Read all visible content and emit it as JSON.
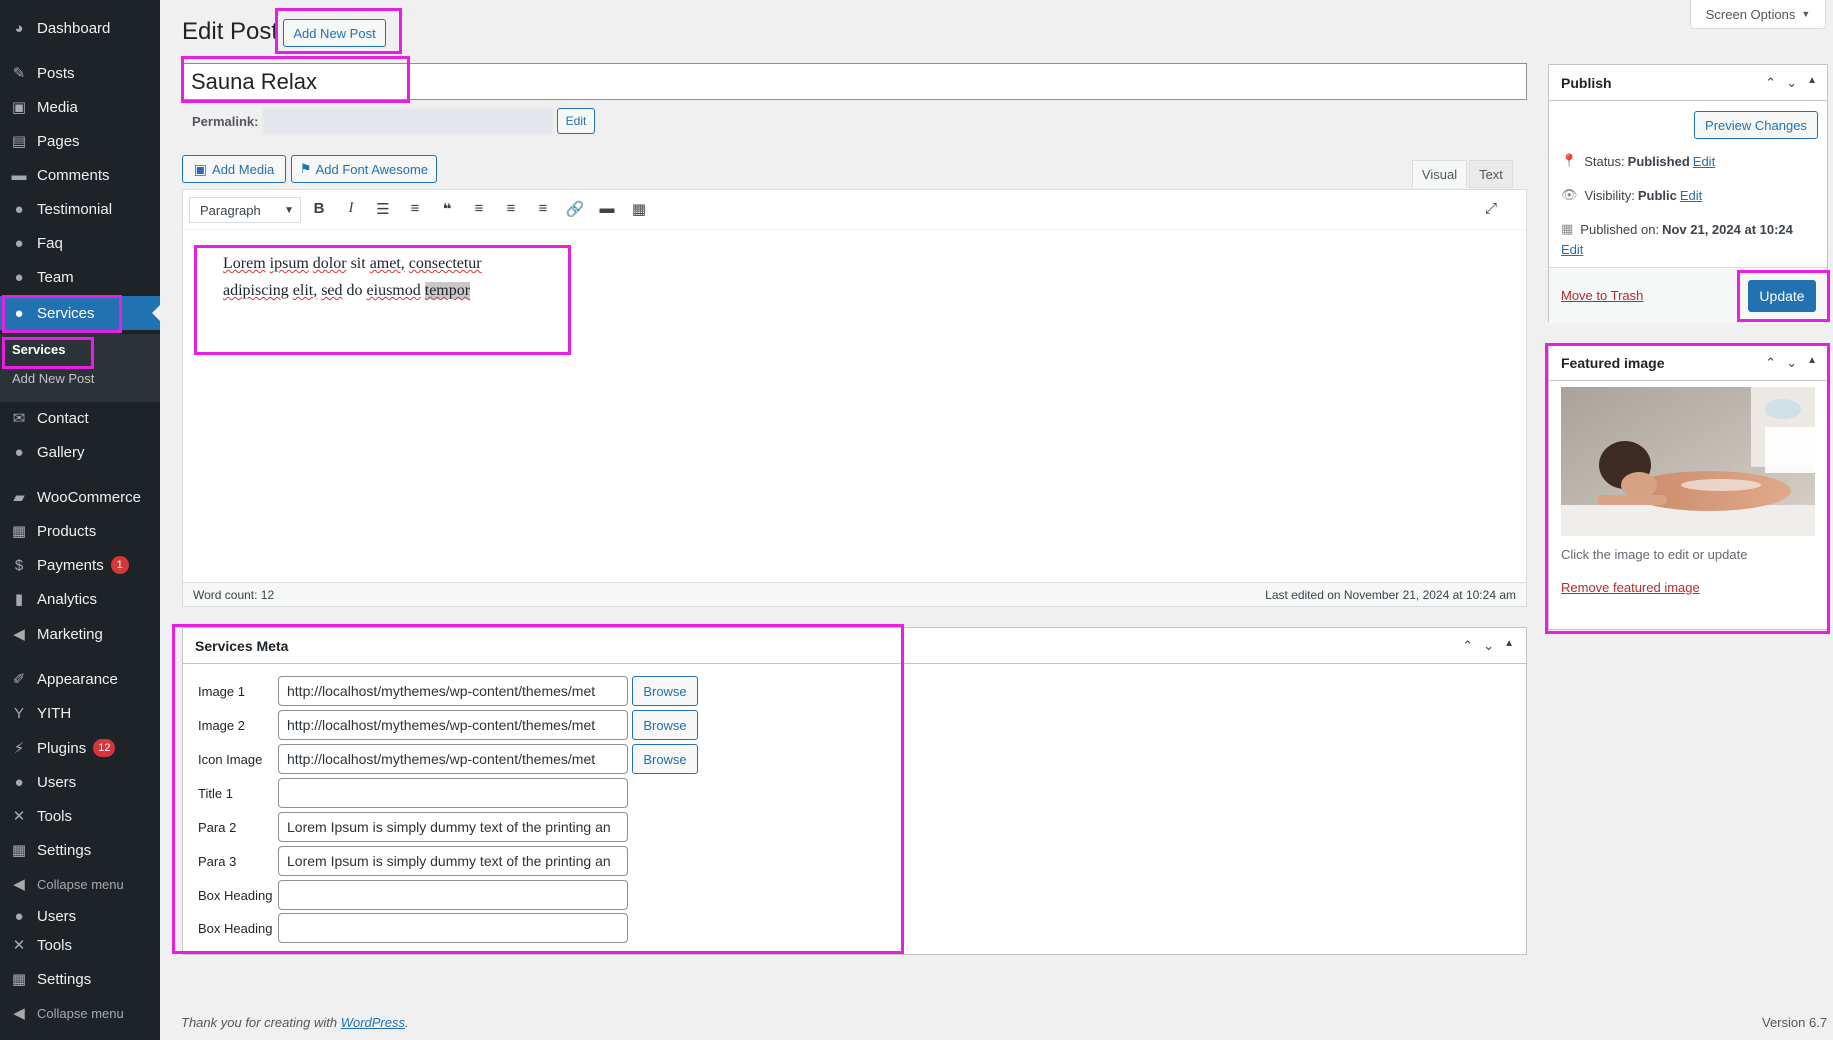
{
  "sidebar": {
    "items": [
      {
        "label": "Dashboard",
        "icon": "dashboard-icon",
        "glyph": "◕"
      },
      {
        "label": "Posts",
        "icon": "pushpin-icon",
        "glyph": "✎"
      },
      {
        "label": "Media",
        "icon": "media-icon",
        "glyph": "▣"
      },
      {
        "label": "Pages",
        "icon": "pages-icon",
        "glyph": "▤"
      },
      {
        "label": "Comments",
        "icon": "comments-icon",
        "glyph": "▬"
      },
      {
        "label": "Testimonial",
        "icon": "user-icon",
        "glyph": "●"
      },
      {
        "label": "Faq",
        "icon": "user-icon",
        "glyph": "●"
      },
      {
        "label": "Team",
        "icon": "user-icon",
        "glyph": "●"
      },
      {
        "label": "Services",
        "icon": "user-icon",
        "glyph": "●"
      },
      {
        "label": "Contact",
        "icon": "mail-icon",
        "glyph": "✉"
      },
      {
        "label": "Gallery",
        "icon": "user-icon",
        "glyph": "●"
      },
      {
        "label": "WooCommerce",
        "icon": "woocommerce-icon",
        "glyph": "▰"
      },
      {
        "label": "Products",
        "icon": "products-icon",
        "glyph": "▦"
      },
      {
        "label": "Payments",
        "icon": "payments-icon",
        "glyph": "$",
        "badge": "1"
      },
      {
        "label": "Analytics",
        "icon": "analytics-icon",
        "glyph": "▮"
      },
      {
        "label": "Marketing",
        "icon": "megaphone-icon",
        "glyph": "◀"
      },
      {
        "label": "Appearance",
        "icon": "brush-icon",
        "glyph": "✐"
      },
      {
        "label": "YITH",
        "icon": "yith-icon",
        "glyph": "Y"
      },
      {
        "label": "Plugins",
        "icon": "plugins-icon",
        "glyph": "⚡",
        "badge": "12"
      },
      {
        "label": "Users",
        "icon": "users-icon",
        "glyph": "●"
      },
      {
        "label": "Tools",
        "icon": "wrench-icon",
        "glyph": "✕"
      },
      {
        "label": "Settings",
        "icon": "settings-icon",
        "glyph": "▦"
      },
      {
        "label": "Collapse menu",
        "icon": "collapse-icon",
        "glyph": "◀"
      },
      {
        "label": "Users",
        "icon": "users-icon",
        "glyph": "●"
      },
      {
        "label": "Tools",
        "icon": "wrench-icon",
        "glyph": "✕"
      },
      {
        "label": "Settings",
        "icon": "settings-icon",
        "glyph": "▦"
      },
      {
        "label": "Collapse menu",
        "icon": "collapse-icon",
        "glyph": "◀"
      }
    ],
    "submenu": [
      "Services",
      "Add New Post"
    ]
  },
  "header": {
    "title": "Edit Post",
    "add_new": "Add New Post",
    "screen_options": "Screen Options"
  },
  "post": {
    "title": "Sauna Relax",
    "permalink_label": "Permalink:",
    "permalink_edit": "Edit"
  },
  "media_buttons": {
    "add_media": "Add Media",
    "add_font_awesome": "Add Font Awesome"
  },
  "editor": {
    "tab_visual": "Visual",
    "tab_text": "Text",
    "format_select": "Paragraph",
    "content_words": [
      "Lorem",
      "ipsum",
      "dolor",
      "sit",
      "amet,",
      "consectetur",
      "adipiscing",
      "elit,",
      "sed",
      "do",
      "eiusmod",
      "tempor"
    ],
    "word_count": "Word count: 12",
    "last_edited": "Last edited on November 21, 2024 at 10:24 am"
  },
  "services_meta": {
    "title": "Services Meta",
    "browse": "Browse",
    "rows": [
      {
        "label": "Image 1",
        "value": "http://localhost/mythemes/wp-content/themes/met"
      },
      {
        "label": "Image 2",
        "value": "http://localhost/mythemes/wp-content/themes/met"
      },
      {
        "label": "Icon Image",
        "value": "http://localhost/mythemes/wp-content/themes/met"
      },
      {
        "label": "Title 1",
        "value": ""
      },
      {
        "label": "Para 2",
        "value": "Lorem Ipsum is simply dummy text of the printing an"
      },
      {
        "label": "Para 3",
        "value": "Lorem Ipsum is simply dummy text of the printing an"
      },
      {
        "label": "Box Heading",
        "value": ""
      },
      {
        "label": "Box Heading",
        "value": ""
      }
    ]
  },
  "publish": {
    "title": "Publish",
    "preview": "Preview Changes",
    "status_label": "Status:",
    "status_value": "Published",
    "visibility_label": "Visibility:",
    "visibility_value": "Public",
    "published_label": "Published on:",
    "published_value": "Nov 21, 2024 at 10:24",
    "edit": "Edit",
    "trash": "Move to Trash",
    "update": "Update"
  },
  "featured": {
    "title": "Featured image",
    "hint": "Click the image to edit or update",
    "remove": "Remove featured image"
  },
  "footer": {
    "thanks": "Thank you for creating with",
    "wp_link": "WordPress",
    "version": "Version 6.7"
  },
  "colors": {
    "accent": "#2271b1",
    "highlight": "#e91ee3",
    "sidebar": "#1d2327"
  }
}
